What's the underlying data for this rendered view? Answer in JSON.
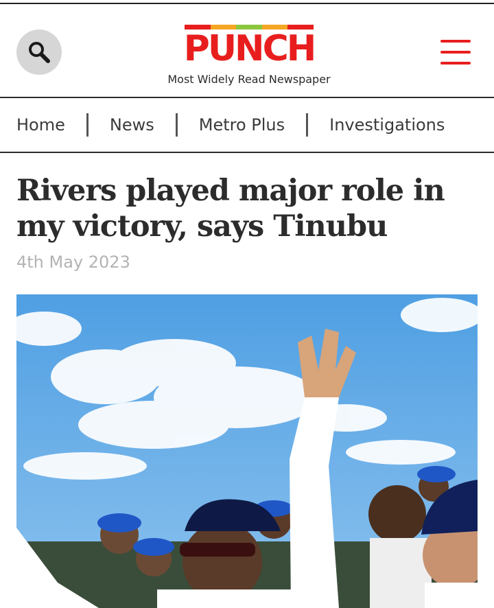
{
  "header": {
    "search_icon": "search-icon",
    "logo_text": "PUNCH",
    "logo_bar_colors": [
      "#e81e1e",
      "#f5a623",
      "#8cc63f",
      "#f5a623",
      "#e81e1e"
    ],
    "tagline": "Most Widely Read Newspaper",
    "menu_icon": "hamburger-menu-icon",
    "accent_color": "#e81e1e"
  },
  "nav": {
    "items": [
      {
        "label": "Home"
      },
      {
        "label": "News"
      },
      {
        "label": "Metro Plus"
      },
      {
        "label": "Investigations"
      }
    ]
  },
  "article": {
    "headline": "Rivers played major role in my victory, says Tinubu",
    "date": "4th May 2023"
  },
  "colors": {
    "sky": "#5aa6e6",
    "text_dark": "#2c2c2c",
    "date_grey": "#b3b3b3"
  }
}
